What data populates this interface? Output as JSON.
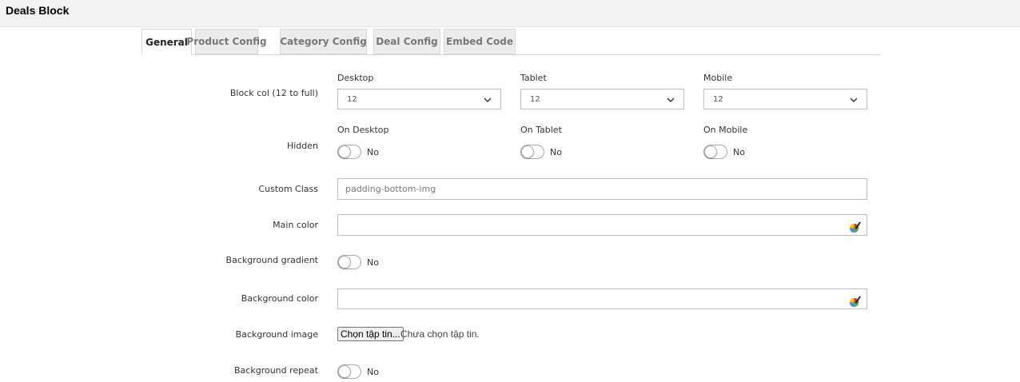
{
  "header": {
    "title": "Deals Block"
  },
  "tabs": [
    {
      "label": "General"
    },
    {
      "label": "Product Config"
    },
    {
      "label": "Category Config"
    },
    {
      "label": "Deal Config"
    },
    {
      "label": "Embed Code"
    }
  ],
  "block_col": {
    "label": "Block col (12 to full)",
    "desktop": {
      "label": "Desktop",
      "value": "12"
    },
    "tablet": {
      "label": "Tablet",
      "value": "12"
    },
    "mobile": {
      "label": "Mobile",
      "value": "12"
    }
  },
  "hidden": {
    "label": "Hidden",
    "desktop": {
      "label": "On Desktop",
      "state": "No"
    },
    "tablet": {
      "label": "On Tablet",
      "state": "No"
    },
    "mobile": {
      "label": "On Mobile",
      "state": "No"
    }
  },
  "custom_class": {
    "label": "Custom Class",
    "value": "padding-bottom-img"
  },
  "main_color": {
    "label": "Main color",
    "value": ""
  },
  "bg_gradient": {
    "label": "Background gradient",
    "state": "No"
  },
  "bg_color": {
    "label": "Background color",
    "value": ""
  },
  "bg_image": {
    "label": "Background image",
    "button": "Chọn tập tin...",
    "status": "Chưa chọn tập tin."
  },
  "bg_repeat": {
    "label": "Background repeat",
    "state": "No"
  }
}
